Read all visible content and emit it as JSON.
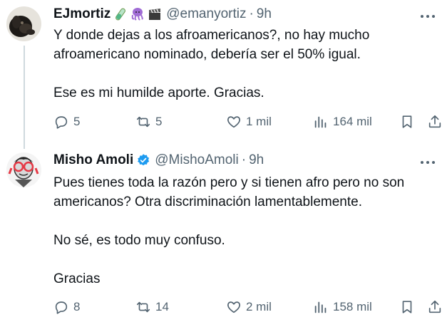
{
  "tweets": [
    {
      "name": "EJmortiz",
      "emojis": [
        "test-tube",
        "octopus",
        "clapper-board"
      ],
      "handle": "@emanyortiz",
      "separator": "·",
      "time": "9h",
      "lines": [
        "Y donde dejas a los afroamericanos?, no hay mucho",
        "afroamericano nominado, debería ser el 50% igual.",
        "",
        "Ese es mi humilde aporte. Gracias."
      ],
      "replies": "5",
      "retweets": "5",
      "likes": "1 mil",
      "views": "164 mil"
    },
    {
      "name": "Misho Amoli",
      "verified": true,
      "handle": "@MishoAmoli",
      "separator": "·",
      "time": "9h",
      "lines": [
        "Pues tienes toda la razón pero y si tienen afro pero no son",
        "americanos? Otra discriminación lamentablemente.",
        "",
        "No sé, es todo muy confuso.",
        "",
        "Gracias"
      ],
      "replies": "8",
      "retweets": "14",
      "likes": "2 mil",
      "views": "158 mil"
    }
  ],
  "colors": {
    "text": "#0f1419",
    "muted": "#536471",
    "verified": "#1d9bf0",
    "line": "#cfd9de"
  }
}
